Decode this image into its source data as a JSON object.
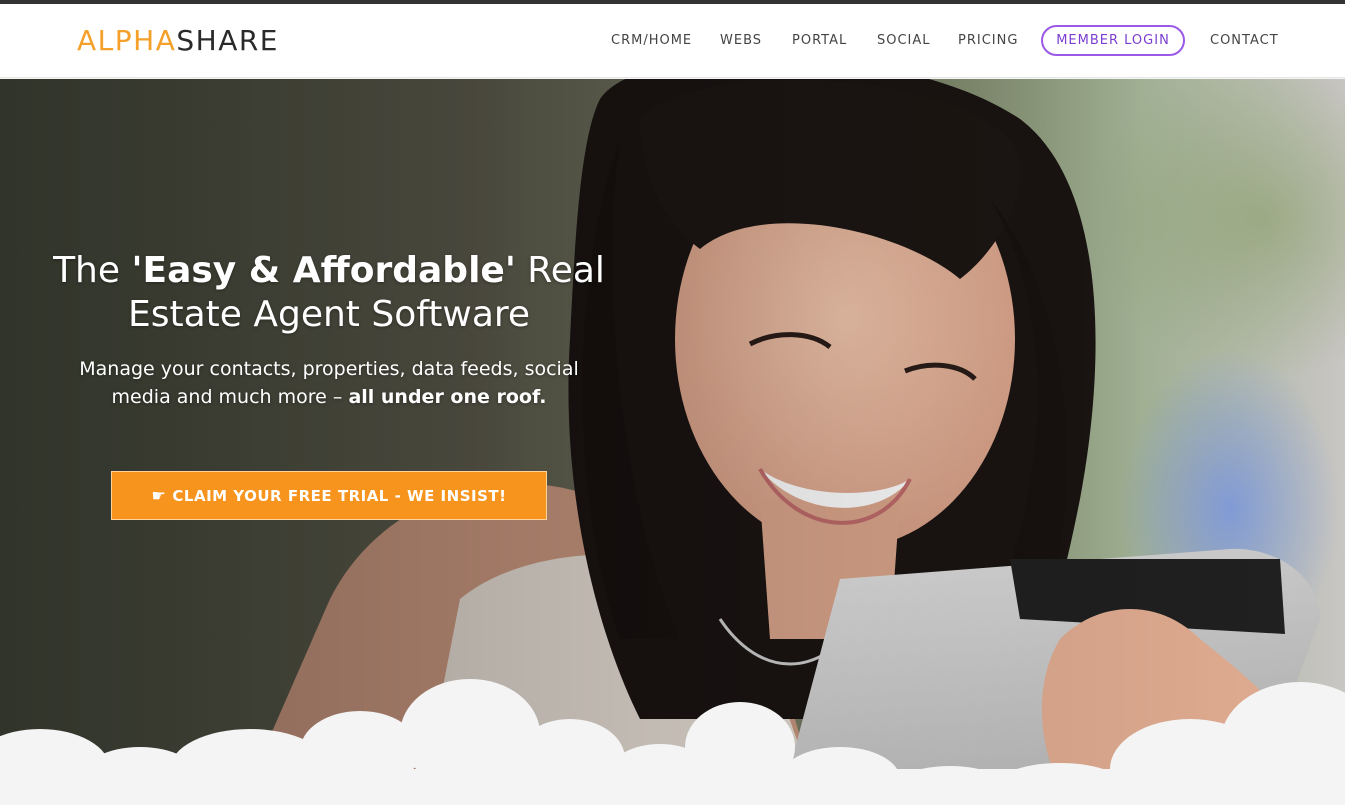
{
  "brand": {
    "logo_alpha": "ALPHA",
    "logo_share": "SHARE",
    "accent": "#f4a02a"
  },
  "nav": {
    "items": [
      "CRM/HOME",
      "WEBS",
      "PORTAL",
      "SOCIAL",
      "PRICING"
    ],
    "login": "MEMBER LOGIN",
    "contact": "CONTACT",
    "login_color": "#9b59e6"
  },
  "hero": {
    "title_pre": "The ",
    "title_bold": "'Easy & Affordable'",
    "title_post": " Real Estate Agent Software",
    "subtitle": "Manage your contacts, properties, data feeds, social media and much more – ",
    "subtitle_bold": "all under one roof.",
    "cta_icon": "pointing-hand-icon",
    "cta_label": "CLAIM YOUR FREE TRIAL - WE INSIST!",
    "cta_color": "#f7941d"
  }
}
